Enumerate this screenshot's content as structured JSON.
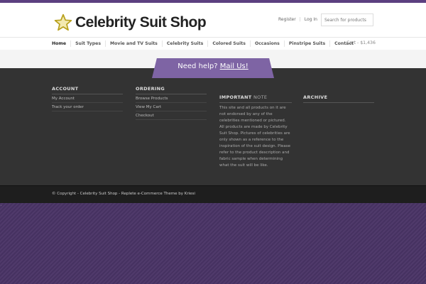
{
  "header": {
    "site_title": "Celebrity Suit Shop",
    "register_label": "Register",
    "separator": "|",
    "login_label": "Log In",
    "search_placeholder": "Search for products"
  },
  "nav": {
    "items": [
      {
        "label": "Home"
      },
      {
        "label": "Suit Types"
      },
      {
        "label": "Movie and TV Suits"
      },
      {
        "label": "Celebrity Suits"
      },
      {
        "label": "Colored Suits"
      },
      {
        "label": "Occasions"
      },
      {
        "label": "Pinstripe Suits"
      },
      {
        "label": "Contact"
      }
    ],
    "cart_label": "Cart - $1,436"
  },
  "help": {
    "text": "Need help?",
    "link": "Mail Us!"
  },
  "footer": {
    "account": {
      "title": "ACCOUNT",
      "links": [
        "My Account",
        "Track your order"
      ]
    },
    "ordering": {
      "title": "ORDERING",
      "links": [
        "Browse Products",
        "View My Cart",
        "Checkout"
      ]
    },
    "note": {
      "title_bold": "IMPORTANT",
      "title_light": "NOTE",
      "text": "This site and all products on it are not endorsed by any of the celebrities mentioned or pictured. All products are made by Celebrity Suit Shop. Pictures of celebrities are only shown as a reference to the inspiration of the suit design. Please refer to the product description and fabric sample when determining what the suit will be like."
    },
    "archive": {
      "title": "ARCHIVE"
    }
  },
  "bottom": {
    "copyright": "© Copyright - Celebrity Suit Shop - Replete e-Commerce Theme by Kriesi"
  },
  "colors": {
    "brand_purple": "#7e64a4",
    "footer_bg": "#333333",
    "page_bg": "#4a3466"
  }
}
